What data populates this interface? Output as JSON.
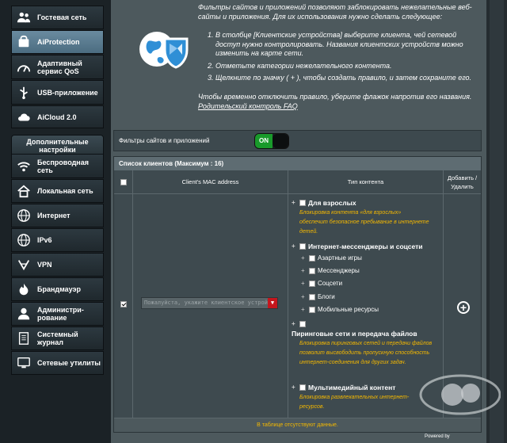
{
  "sidebar": {
    "items_top": [
      {
        "label": "Гостевая сеть",
        "icon": "guest-network-icon"
      },
      {
        "label": "AiProtection",
        "icon": "aiprotection-icon",
        "active": true
      },
      {
        "label": "Адаптивный сервис QoS",
        "icon": "qos-icon"
      },
      {
        "label": "USB-приложение",
        "icon": "usb-icon"
      },
      {
        "label": "AiCloud 2.0",
        "icon": "cloud-icon"
      }
    ],
    "advanced_header": "Дополнительные настройки",
    "items_advanced": [
      {
        "label": "Беспроводная сеть",
        "icon": "wireless-icon"
      },
      {
        "label": "Локальная сеть",
        "icon": "home-lan-icon"
      },
      {
        "label": "Интернет",
        "icon": "globe-icon"
      },
      {
        "label": "IPv6",
        "icon": "ipv6-globe-icon"
      },
      {
        "label": "VPN",
        "icon": "vpn-icon"
      },
      {
        "label": "Брандмауэр",
        "icon": "firewall-icon"
      },
      {
        "label": "Администри-рование",
        "icon": "admin-icon"
      },
      {
        "label": "Системный журнал",
        "icon": "log-icon"
      },
      {
        "label": "Сетевые утилиты",
        "icon": "tools-icon"
      }
    ]
  },
  "description": {
    "intro": "Фильтры сайтов и приложений позволяют заблокировать нежелательные веб-сайты и приложения. Для их использования нужно сделать следующее:",
    "steps": [
      "В столбце [Клиентские устройства] выберите клиента, чей сетевой доступ нужно контролировать. Названия клиентских устройств можно изменить на карте сети.",
      "Отметьте категории нежелательного контента.",
      "Щелкните по значку ( + ), чтобы создать правило, и затем сохраните его."
    ],
    "note": "Чтобы временно отключить правило, уберите флажок напротив его названия.",
    "faq_link": "Родительский контроль FAQ"
  },
  "filter": {
    "label": "Фильтры сайтов и приложений",
    "toggle_state": "ON"
  },
  "client_list": {
    "title": "Список клиентов (Максимум : 16)",
    "headers": {
      "mac": "Client's MAC address",
      "content_type": "Тип контента",
      "add_delete": "Добавить / Удалить"
    },
    "mac_placeholder": "Пожалуйста, укажите клиентское устройство",
    "categories": {
      "adult": "Для взрослых",
      "adult_desc": "Блокировка контента «для взрослых» обеспечит безопасное пребывание в интернете детей.",
      "messengers": "Интернет-мессенджеры и соцсети",
      "sub": [
        "Азартные игры",
        "Мессенджеры",
        "Соцсети",
        "Блоги",
        "Мобильные ресурсы"
      ],
      "p2p": "Пиринговые сети и передача файлов",
      "p2p_desc": "Блокировка пиринговых сетей и передачи файлов позволит высвободить пропускную способность интернет-соединения для других задач.",
      "multimedia": "Мультимедийный контент",
      "multimedia_desc": "Блокировка развлекательных интернет-ресурсов."
    },
    "add_symbol": "+",
    "empty_text": "В таблице отсутствуют данные."
  },
  "powered_by": "Powered by"
}
